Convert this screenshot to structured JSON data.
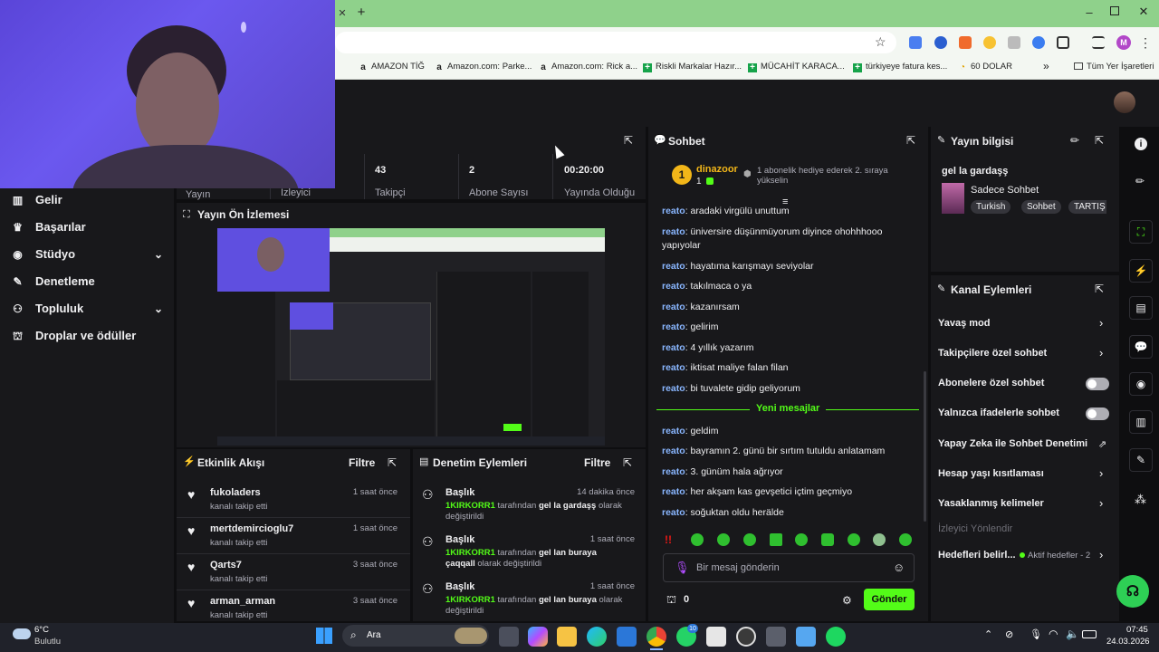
{
  "bookmarks": [
    {
      "label": "AMAZON TİĞ",
      "icon": "a"
    },
    {
      "label": "Amazon.com: Parke...",
      "icon": "a"
    },
    {
      "label": "Amazon.com: Rick a...",
      "icon": "a"
    },
    {
      "label": "Riskli Markalar Hazır...",
      "icon": "+"
    },
    {
      "label": "MÜCAHİT KARACA...",
      "icon": "+"
    },
    {
      "label": "türkiyeye fatura kes...",
      "icon": "+"
    },
    {
      "label": "60 DOLAR",
      "icon": "◔"
    }
  ],
  "bookmarks_more": "»",
  "all_bookmarks": "Tüm Yer İşaretleri",
  "profile_initial": "M",
  "nav": [
    {
      "label": "Gelir",
      "icon": "chart-icon"
    },
    {
      "label": "Başarılar",
      "icon": "trophy-icon"
    },
    {
      "label": "Stüdyo",
      "icon": "camera-icon",
      "expand": true
    },
    {
      "label": "Denetleme",
      "icon": "wrench-icon"
    },
    {
      "label": "Topluluk",
      "icon": "people-icon",
      "expand": true
    },
    {
      "label": "Droplar ve ödüller",
      "icon": "gift-icon"
    }
  ],
  "stats": [
    {
      "value": "",
      "label": "Yayın"
    },
    {
      "value": "",
      "label": "İzleyici"
    },
    {
      "value": "43",
      "label": "Takipçi"
    },
    {
      "value": "2",
      "label": "Abone Sayısı"
    },
    {
      "value": "00:20:00",
      "label": "Yayında Olduğu"
    }
  ],
  "preview": {
    "title": "Yayın Ön İzlemesi"
  },
  "activity": {
    "title": "Etkinlik Akışı",
    "filter": "Filtre",
    "items": [
      {
        "name": "fukoladers",
        "sub": "kanalı takip etti",
        "time": "1 saat önce"
      },
      {
        "name": "mertdemircioglu7",
        "sub": "kanalı takip etti",
        "time": "1 saat önce"
      },
      {
        "name": "Qarts7",
        "sub": "kanalı takip etti",
        "time": "3 saat önce"
      },
      {
        "name": "arman_arman",
        "sub": "kanalı takip etti",
        "time": "3 saat önce"
      }
    ]
  },
  "moderation": {
    "title": "Denetim Eylemleri",
    "filter": "Filtre",
    "items": [
      {
        "name": "Başlık",
        "time": "14 dakika önce",
        "user": "1KIRKORR1",
        "mid": " tarafından ",
        "value": "gel la gardaşş",
        "end": " olarak değiştirildi"
      },
      {
        "name": "Başlık",
        "time": "1 saat önce",
        "user": "1KIRKORR1",
        "mid": " tarafından ",
        "value": "gel lan buraya çaqqall",
        "end": " olarak değiştirildi"
      },
      {
        "name": "Başlık",
        "time": "1 saat önce",
        "user": "1KIRKORR1",
        "mid": " tarafından ",
        "value": "gel lan buraya",
        "end": " olarak değiştirildi"
      }
    ]
  },
  "chat": {
    "title": "Sohbet",
    "pinned_user": "dinazoor",
    "pinned_rank": "1",
    "pinned_count": "1",
    "pinned_text": "1 abonelik hediye ederek 2. sıraya yükselin",
    "messages": [
      {
        "user": "reato",
        "text": "aradaki virgülü unuttum"
      },
      {
        "user": "reato",
        "text": "üniversire düşünmüyorum diyince ohohhhooo yapıyolar"
      },
      {
        "user": "reato",
        "text": "hayatıma karışmayı seviyolar"
      },
      {
        "user": "reato",
        "text": "takılmaca o ya"
      },
      {
        "user": "reato",
        "text": "kazanırsam"
      },
      {
        "user": "reato",
        "text": "gelirim"
      },
      {
        "user": "reato",
        "text": "4 yıllık yazarım"
      },
      {
        "user": "reato",
        "text": "iktisat maliye falan filan"
      },
      {
        "user": "reato",
        "text": "bi tuvalete gidip geliyorum"
      }
    ],
    "new_messages": "Yeni mesajlar",
    "messages_new": [
      {
        "user": "reato",
        "text": "geldim"
      },
      {
        "user": "reato",
        "text": "bayramın 2. günü bir sırtım tutuldu anlatamam"
      },
      {
        "user": "reato",
        "text": "3. günüm hala ağrıyor"
      },
      {
        "user": "reato",
        "text": "her akşam kas gevşetici içtim geçmiyo"
      },
      {
        "user": "reato",
        "text": "soğuktan oldu herälde"
      }
    ],
    "input_placeholder": "Bir mesaj gönderin",
    "points": "0",
    "send": "Gönder"
  },
  "stream_info": {
    "title": "Yayın bilgisi",
    "stream_title": "gel la gardaşş",
    "category": "Sadece Sohbet",
    "tags": [
      "Turkish",
      "Sohbet",
      "TARTIŞ"
    ]
  },
  "channel_actions": {
    "title": "Kanal Eylemleri",
    "items": [
      {
        "label": "Yavaş mod",
        "control": "arrow"
      },
      {
        "label": "Takipçilere özel sohbet",
        "control": "arrow"
      },
      {
        "label": "Abonelere özel sohbet",
        "control": "toggle"
      },
      {
        "label": "Yalnızca ifadelerle sohbet",
        "control": "toggle"
      },
      {
        "label": "Yapay Zeka ile Sohbet Denetimi",
        "control": "external"
      },
      {
        "label": "Hesap yaşı kısıtlaması",
        "control": "arrow"
      },
      {
        "label": "Yasaklanmış kelimeler",
        "control": "arrow"
      }
    ],
    "section": "İzleyici Yönlendir",
    "goals_label": "Hedefleri belirl...",
    "goals_status": "Aktif hedefler - 2"
  },
  "taskbar": {
    "weather_temp": "6°C",
    "weather_desc": "Bulutlu",
    "search": "Ara",
    "time": "07:45",
    "date": "24.03.2026",
    "badge": "10"
  },
  "colors": {
    "accent": "#53fc18",
    "panel": "#18181b",
    "bg": "#0e0e10",
    "username": "#89b6ff"
  }
}
